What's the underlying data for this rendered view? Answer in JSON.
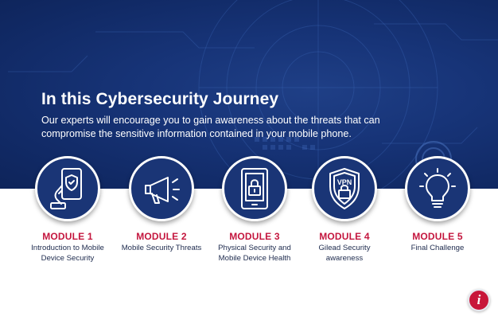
{
  "hero": {
    "title": "In this Cybersecurity Journey",
    "subtitle": "Our experts will encourage you to gain awareness about the threats that can compromise the sensitive information contained in your mobile phone."
  },
  "modules": [
    {
      "label": "MODULE 1",
      "description": "Introduction to Mobile Device Security",
      "icon": "hand-holding-phone-shield-icon"
    },
    {
      "label": "MODULE 2",
      "description": "Mobile Security Threats",
      "icon": "megaphone-icon"
    },
    {
      "label": "MODULE 3",
      "description": "Physical Security and Mobile Device Health",
      "icon": "tablet-lock-icon"
    },
    {
      "label": "MODULE 4",
      "description": "Gilead Security awareness",
      "icon": "vpn-shield-icon"
    },
    {
      "label": "MODULE 5",
      "description": "Final Challenge",
      "icon": "lightbulb-icon"
    }
  ],
  "info_button": {
    "label": "i",
    "icon": "info-icon"
  },
  "colors": {
    "hero_background": "#173478",
    "module_label": "#c4163e",
    "description_text": "#1d2a4d",
    "info_button": "#c8163a"
  }
}
